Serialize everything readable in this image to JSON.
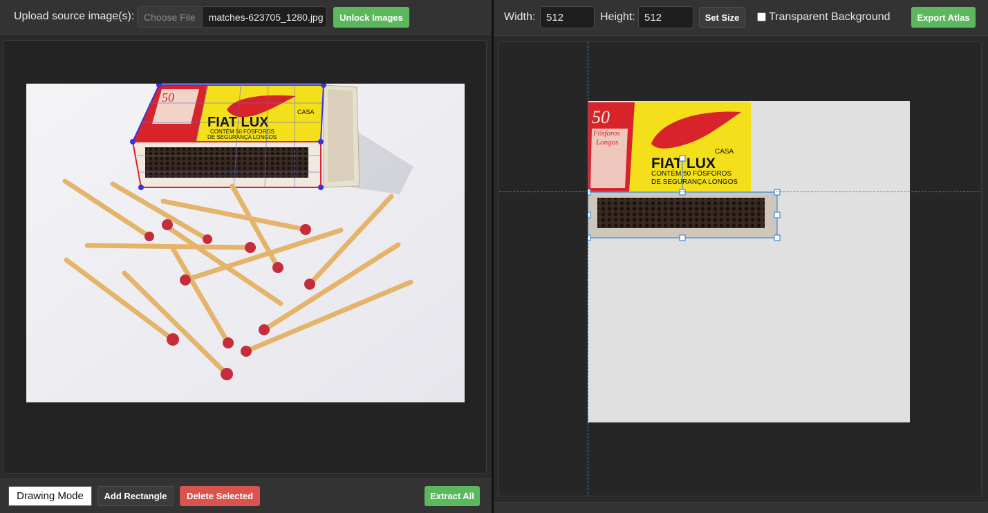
{
  "left_toolbar": {
    "upload_label": "Upload source image(s):",
    "choose_file_label": "Choose File",
    "file_name": "matches-623705_1280.jpg",
    "unlock_label": "Unlock Images"
  },
  "left_footer": {
    "drawing_mode_label": "Drawing Mode",
    "add_rectangle_label": "Add Rectangle",
    "delete_selected_label": "Delete Selected",
    "extract_all_label": "Extract All"
  },
  "right_toolbar": {
    "width_label": "Width:",
    "width_value": "512",
    "height_label": "Height:",
    "height_value": "512",
    "set_size_label": "Set Size",
    "transparent_label": "Transparent Background",
    "transparent_checked": false,
    "export_label": "Export Atlas"
  },
  "matchbox": {
    "count": "50",
    "fosforos": "Fósforos",
    "longos": "Longos",
    "brand": "FIAT LUX",
    "casa": "CASA",
    "line1": "CONTÉM 50 FÓSFOROS",
    "line2": "DE SEGURANÇA LONGOS"
  },
  "colors": {
    "accent_green": "#5cb85c",
    "danger_red": "#d9534f",
    "selection_blue": "#3b8ed6",
    "polygon_blue": "#3a32d8",
    "polygon_red": "#e0202a"
  }
}
